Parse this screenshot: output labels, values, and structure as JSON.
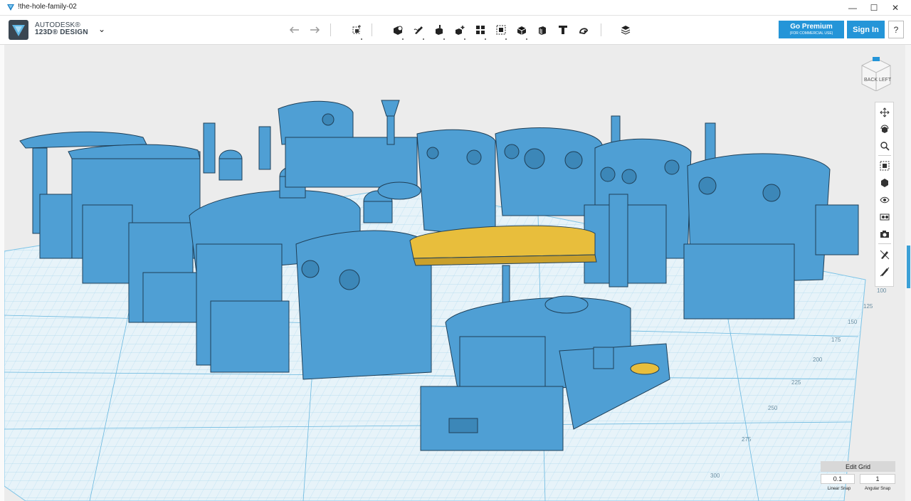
{
  "window": {
    "title": "!the-hole-family-02",
    "minimize": "—",
    "maximize": "☐",
    "close": "✕"
  },
  "app": {
    "brand_line1": "AUTODESK®",
    "brand_line2": "123D® DESIGN"
  },
  "toolbar": {
    "tools": [
      "undo-icon",
      "redo-icon",
      "transform-icon",
      "primitives-icon",
      "sketch-icon",
      "construct-icon",
      "modify-icon",
      "pattern-icon",
      "grouping-icon",
      "combine-icon",
      "measure-icon",
      "text-icon",
      "snap-icon",
      "material-icon"
    ]
  },
  "header": {
    "premium_label": "Go Premium",
    "premium_sub": "(FOR COMMERCIAL USE)",
    "signin_label": "Sign In",
    "help_label": "?"
  },
  "viewcube": {
    "face_back": "BACK",
    "face_left": "LEFT"
  },
  "grid": {
    "tick_labels": [
      "100",
      "125",
      "150",
      "175",
      "200",
      "225",
      "250",
      "275",
      "300"
    ],
    "edit_grid_label": "Edit Grid",
    "linear_snap_value": "0.1",
    "angular_snap_value": "1",
    "linear_snap_label": "Linear Snap",
    "angular_snap_label": "Angular Snap"
  },
  "colors": {
    "model_blue": "#4f9fd4",
    "selected_yellow": "#e8be3c",
    "accent": "#2495d8",
    "grid_line": "#7cc3e6"
  }
}
